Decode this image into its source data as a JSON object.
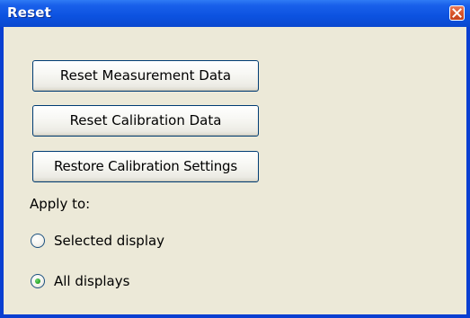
{
  "window": {
    "title": "Reset",
    "close_icon": "close-icon",
    "colors": {
      "titlebar": "#0c52e0",
      "client": "#ece9d8",
      "close": "#d9552c"
    }
  },
  "buttons": {
    "reset_measurement": "Reset Measurement Data",
    "reset_calibration": "Reset Calibration Data",
    "restore_calibration": "Restore Calibration Settings"
  },
  "apply_to": {
    "label": "Apply to:",
    "options": [
      {
        "label": "Selected display",
        "selected": false
      },
      {
        "label": "All displays",
        "selected": true
      }
    ]
  }
}
